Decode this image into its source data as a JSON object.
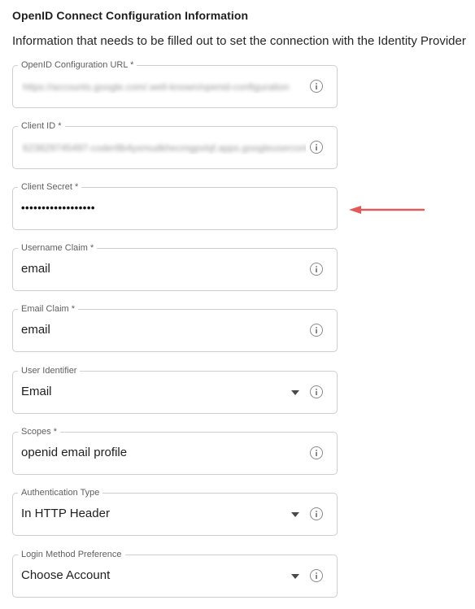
{
  "section": {
    "title": "OpenID Connect Configuration Information",
    "description": "Information that needs to be filled out to set the connection with the Identity Provider"
  },
  "fields": [
    {
      "label": "OpenID Configuration URL *",
      "value": "https://accounts.google.com/.well-known/openid-configuration",
      "blurred": true,
      "icon": "info-icon"
    },
    {
      "label": "Client ID *",
      "value": "623829745497-coder8b4yxmudkhecmgpvlqf.apps.googleusercontent.com",
      "blurred": true,
      "icon": "info-icon"
    },
    {
      "label": "Client Secret *",
      "value": "••••••••••••••••••",
      "icon": "none"
    },
    {
      "label": "Username Claim *",
      "value": "email",
      "icon": "info-icon"
    },
    {
      "label": "Email Claim *",
      "value": "email",
      "icon": "info-icon"
    },
    {
      "label": "User Identifier",
      "value": "Email",
      "icon": "info-icon",
      "dropdown": true
    },
    {
      "label": "Scopes *",
      "value": "openid email profile",
      "icon": "info-icon"
    },
    {
      "label": "Authentication Type",
      "value": "In HTTP Header",
      "icon": "info-icon",
      "dropdown": true
    },
    {
      "label": "Login Method Preference",
      "value": "Choose Account",
      "icon": "info-icon",
      "dropdown": true
    }
  ],
  "annotation": {
    "arrow_color": "#e05a5a",
    "points_to": "Client Secret *"
  }
}
